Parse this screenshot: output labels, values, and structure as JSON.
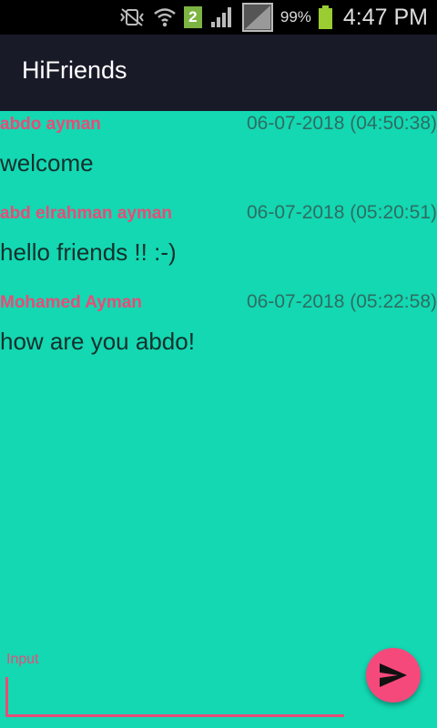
{
  "status_bar": {
    "sim_slot": "2",
    "battery_percent": "99%",
    "time": "4:47 PM",
    "icons": [
      "mute-vibrate-icon",
      "wifi-icon",
      "sim-icon",
      "signal-icon",
      "no-signal-icon",
      "battery-icon"
    ]
  },
  "app_bar": {
    "title": "HiFriends"
  },
  "messages": [
    {
      "sender": "abdo ayman",
      "time": "06-07-2018 (04:50:38)",
      "text": "welcome"
    },
    {
      "sender": "abd elrahman ayman",
      "time": "06-07-2018 (05:20:51)",
      "text": "hello friends !! :-)"
    },
    {
      "sender": "Mohamed Ayman",
      "time": "06-07-2018 (05:22:58)",
      "text": "how are you abdo!"
    }
  ],
  "composer": {
    "label": "Input",
    "value": "",
    "send_icon": "send-icon"
  },
  "colors": {
    "background": "#13d8b2",
    "app_bar": "#181a28",
    "accent": "#f5497c",
    "sender_name": "#e84c78",
    "timestamp": "#2e6e62"
  }
}
